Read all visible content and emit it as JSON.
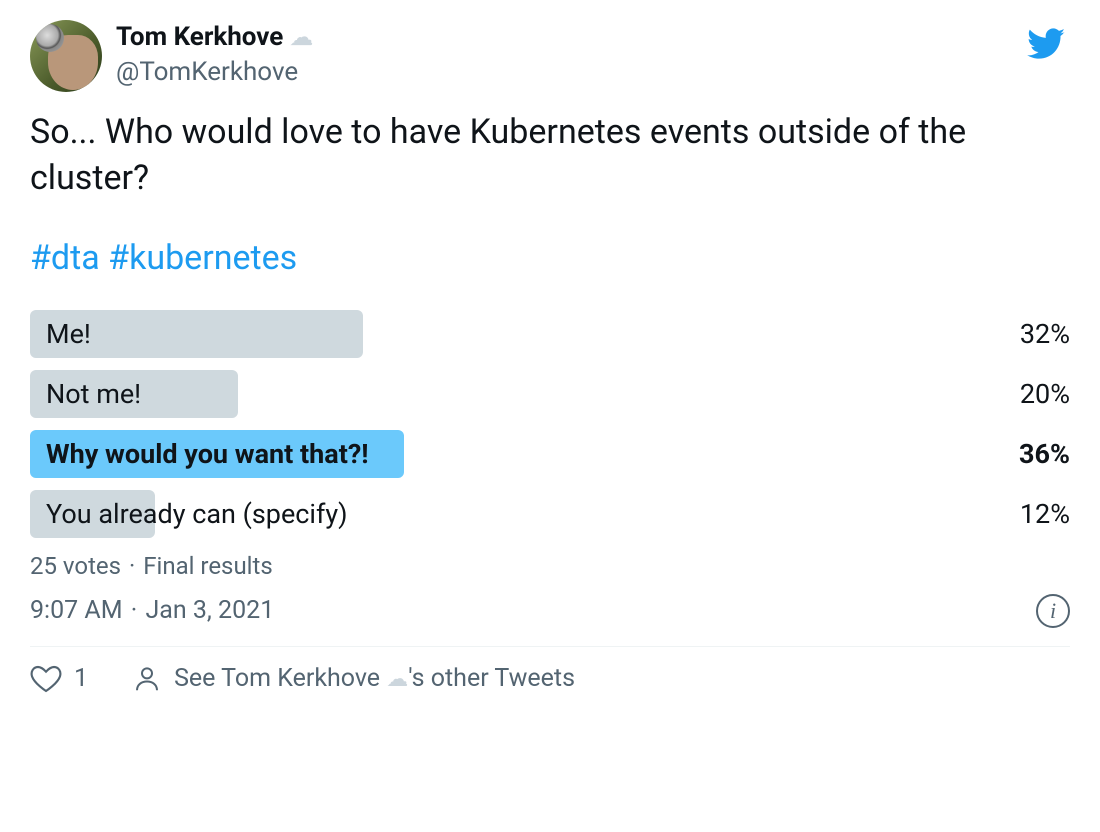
{
  "author": {
    "display_name": "Tom Kerkhove",
    "handle": "@TomKerkhove"
  },
  "tweet": {
    "text": "So... Who would love to have Kubernetes events outside of the cluster?",
    "hashtags": [
      "#dta",
      "#kubernetes"
    ]
  },
  "poll": {
    "options": [
      {
        "label": "Me!",
        "pct": "32%",
        "bar_width": "32%",
        "winner": false
      },
      {
        "label": "Not me!",
        "pct": "20%",
        "bar_width": "20%",
        "winner": false
      },
      {
        "label": "Why would you want that?!",
        "pct": "36%",
        "bar_width": "36%",
        "winner": true
      },
      {
        "label": "You already can (specify)",
        "pct": "12%",
        "bar_width": "12%",
        "winner": false
      }
    ],
    "votes_text": "25 votes",
    "status_text": "Final results"
  },
  "meta": {
    "time": "9:07 AM",
    "date": "Jan 3, 2021"
  },
  "actions": {
    "like_count": "1",
    "see_other_prefix": "See Tom Kerkhove ",
    "see_other_suffix": "'s other Tweets"
  },
  "chart_data": {
    "type": "bar",
    "orientation": "horizontal",
    "title": "So... Who would love to have Kubernetes events outside of the cluster?",
    "categories": [
      "Me!",
      "Not me!",
      "Why would you want that?!",
      "You already can (specify)"
    ],
    "values": [
      32,
      20,
      36,
      12
    ],
    "unit": "percent",
    "n": 25,
    "xlim": [
      0,
      100
    ]
  }
}
